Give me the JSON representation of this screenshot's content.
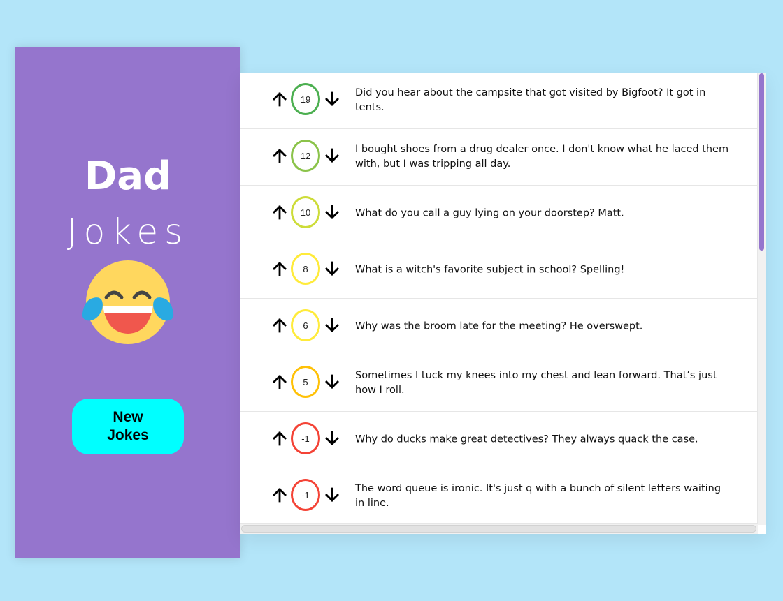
{
  "sidebar": {
    "title_main": "Dad",
    "title_sub": "Jokes",
    "emoji": "face-with-tears-of-joy-icon",
    "new_button_label": "New\nJokes"
  },
  "colors": {
    "background": "#b3e5f9",
    "sidebar": "#9575cd",
    "button": "#00ffff",
    "scroll_thumb": "#9575cd"
  },
  "jokes": [
    {
      "score": "19",
      "text": "Did you hear about the campsite that got visited by Bigfoot? It got in tents.",
      "ring_color": "#4caf50"
    },
    {
      "score": "12",
      "text": "I bought shoes from a drug dealer once. I don't know what he laced them with, but I was tripping all day.",
      "ring_color": "#8bc34a"
    },
    {
      "score": "10",
      "text": "What do you call a guy lying on your doorstep? Matt.",
      "ring_color": "#cddc39"
    },
    {
      "score": "8",
      "text": "What is a witch's favorite subject in school? Spelling!",
      "ring_color": "#ffeb3b"
    },
    {
      "score": "6",
      "text": "Why was the broom late for the meeting? He overswept.",
      "ring_color": "#ffeb3b"
    },
    {
      "score": "5",
      "text": "Sometimes I tuck my knees into my chest and lean forward. That’s just how I roll.",
      "ring_color": "#ffc107"
    },
    {
      "score": "-1",
      "text": "Why do ducks make great detectives? They always quack the case.",
      "ring_color": "#f44336"
    },
    {
      "score": "-1",
      "text": "The word queue is ironic. It's just q with a bunch of silent letters waiting in line.",
      "ring_color": "#f44336"
    }
  ]
}
